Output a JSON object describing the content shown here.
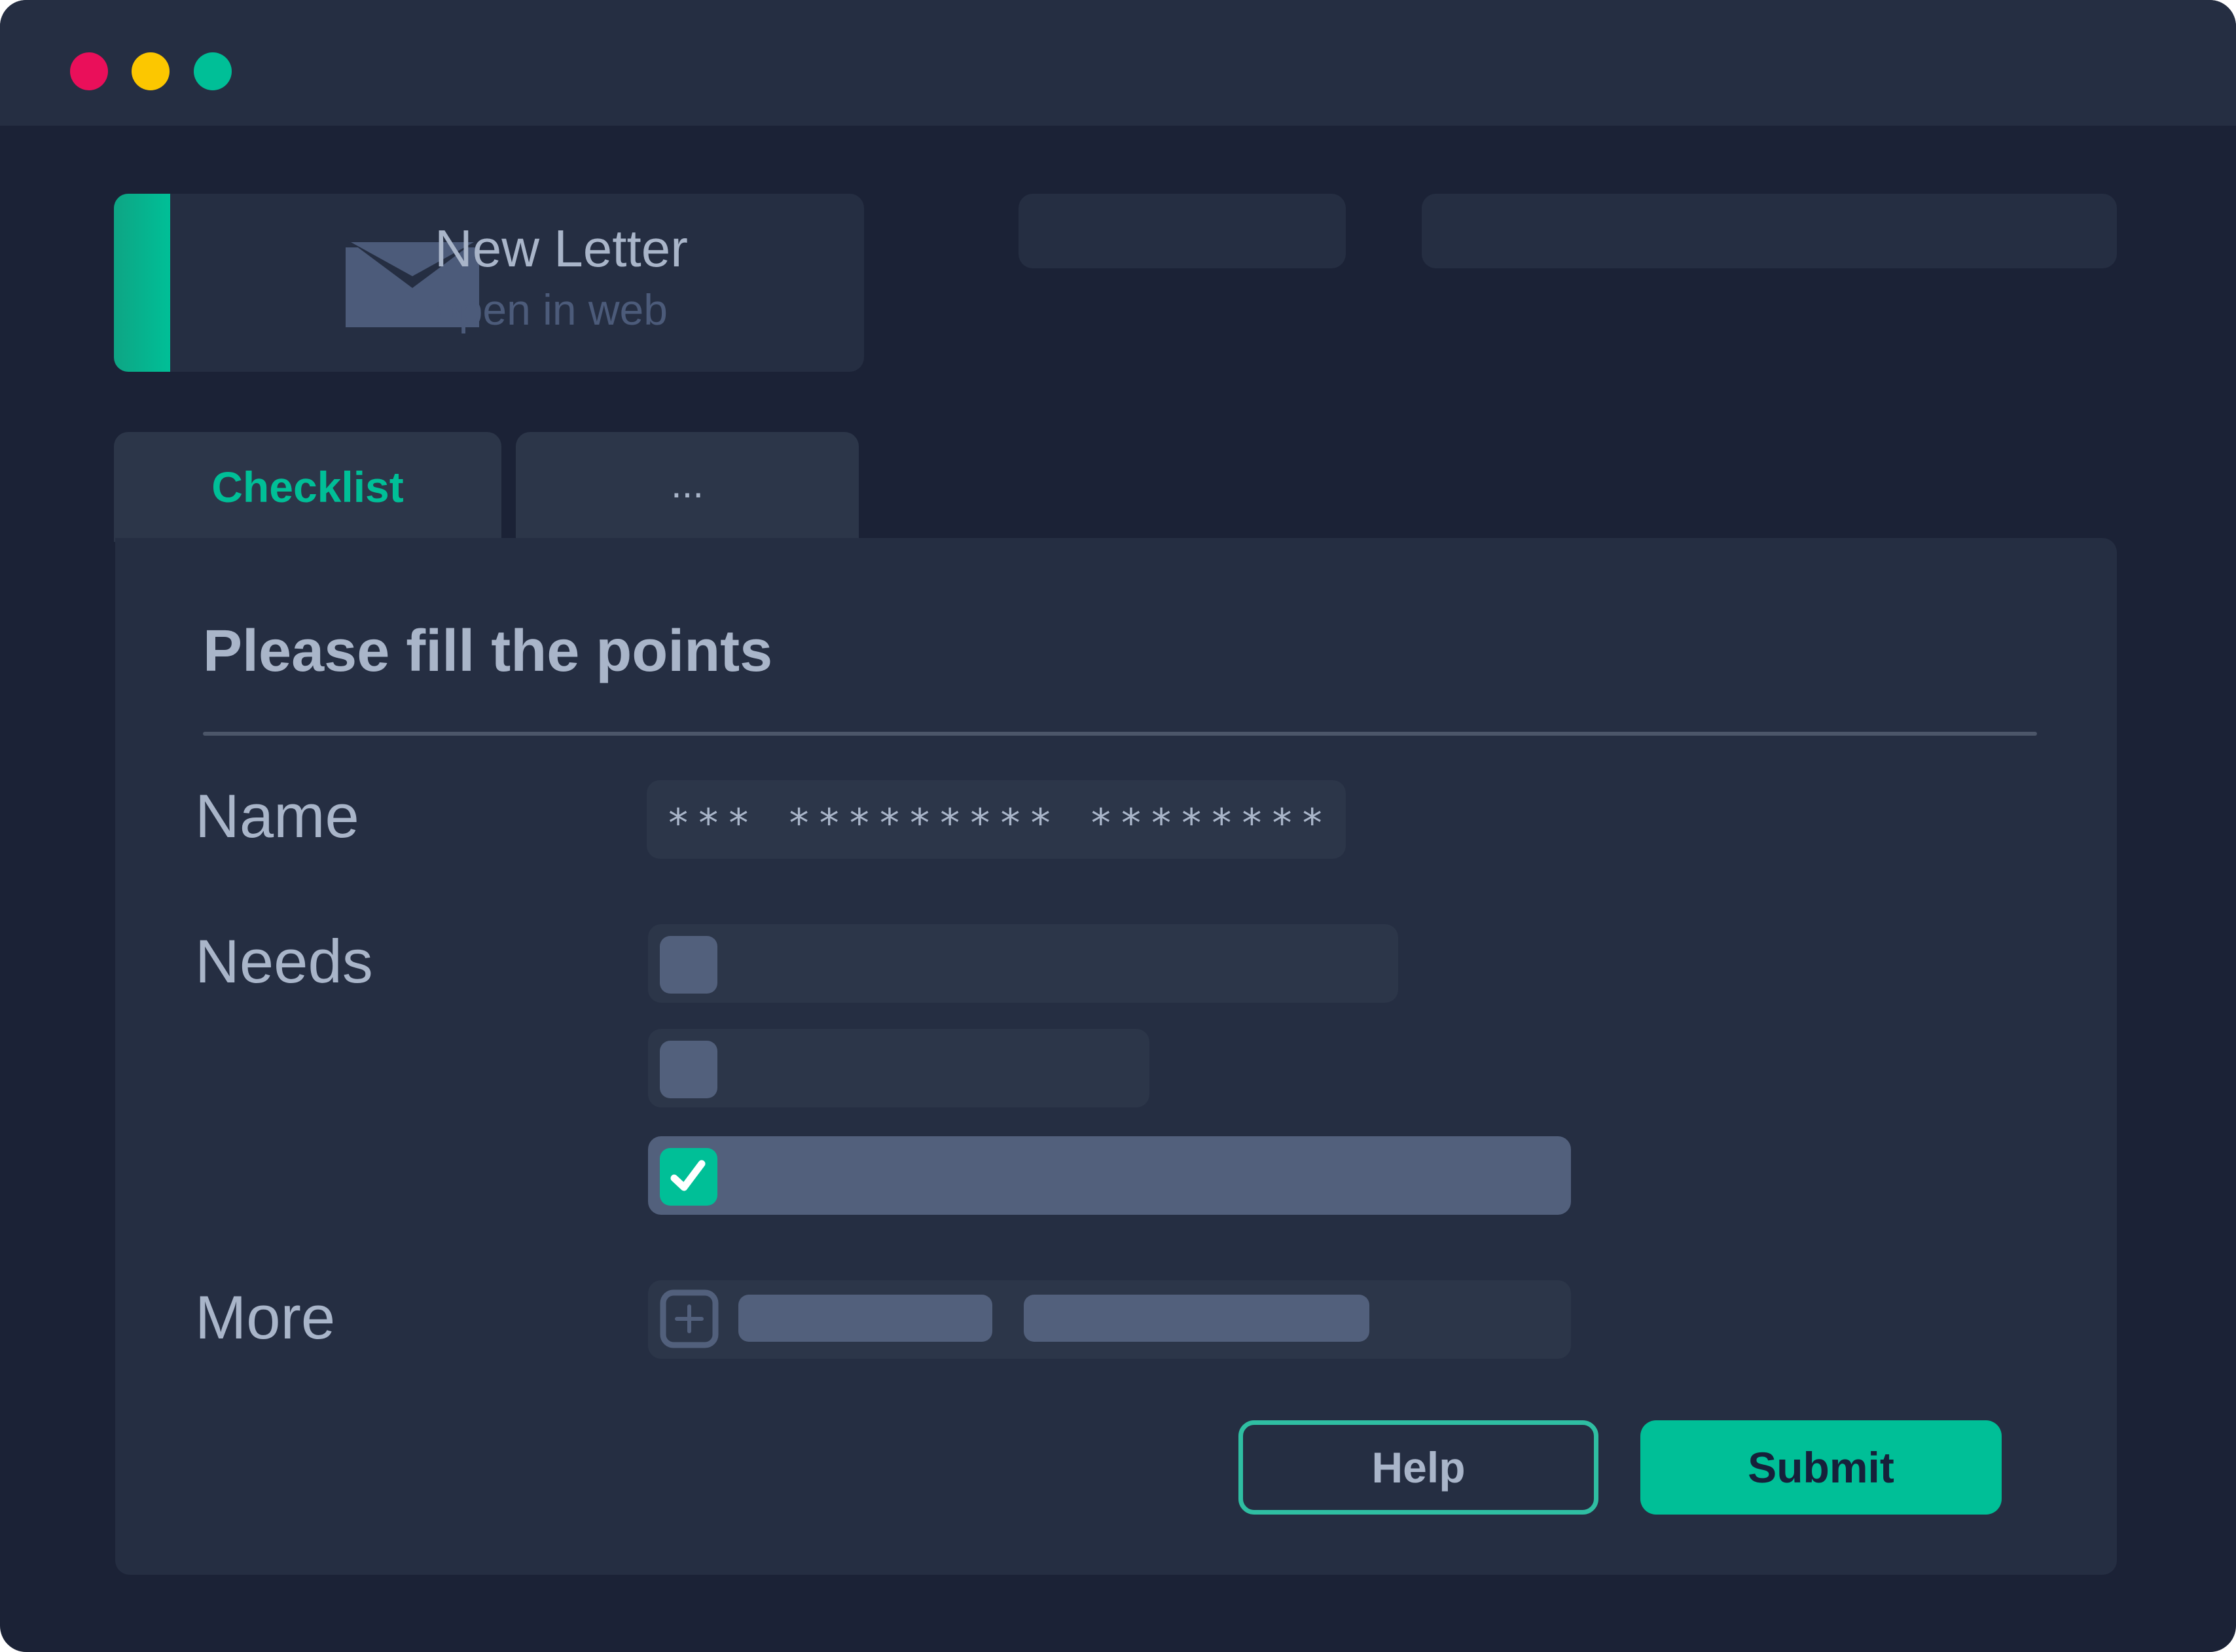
{
  "colors": {
    "window_bg": "#1b2236",
    "titlebar_bg": "#252e42",
    "panel_bg": "#252e42",
    "accent": "#00bf97",
    "text_primary": "#a9b5c9",
    "text_muted": "#4c5b7a",
    "traffic_red": "#ea0f5a",
    "traffic_yellow": "#fcc700",
    "traffic_green": "#00bf97"
  },
  "window_controls": {
    "close_icon": "red-dot-icon",
    "minimize_icon": "yellow-dot-icon",
    "maximize_icon": "green-dot-icon"
  },
  "mail_card": {
    "icon": "envelope-icon",
    "title": "New Letter",
    "subtitle": "open in web"
  },
  "tabs": [
    {
      "label": "Checklist",
      "active": true
    },
    {
      "label": "...",
      "active": false
    }
  ],
  "form": {
    "heading": "Please fill the points",
    "name_label": "Name",
    "name_value": "*** ********* ********",
    "needs_label": "Needs",
    "needs": [
      {
        "checked": false
      },
      {
        "checked": false
      },
      {
        "checked": true
      }
    ],
    "more_label": "More",
    "more_icon": "plus-icon"
  },
  "buttons": {
    "help": "Help",
    "submit": "Submit"
  }
}
